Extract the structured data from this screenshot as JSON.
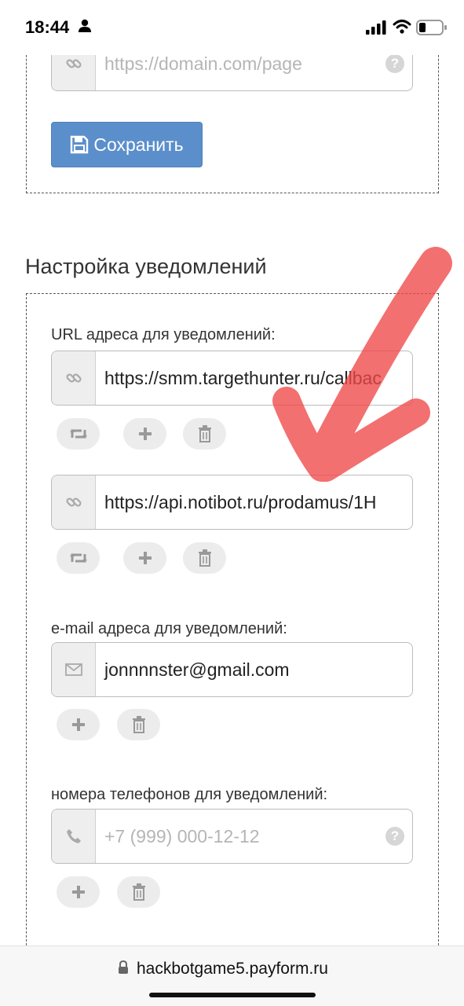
{
  "status_bar": {
    "time": "18:44",
    "icons": [
      "person-icon",
      "signal-icon",
      "wifi-icon",
      "battery-icon"
    ]
  },
  "top_section": {
    "url_field": {
      "placeholder": "https://domain.com/page",
      "icon": "link-icon",
      "help": "?"
    },
    "save_button": {
      "label": "Сохранить",
      "icon": "floppy-disk-icon"
    }
  },
  "notifications": {
    "title": "Настройка уведомлений",
    "url_label": "URL адреса для уведомлений:",
    "url_fields": [
      {
        "value": "https://smm.targethunter.ru/callbac",
        "icon": "link-icon"
      },
      {
        "value": "https://api.notibot.ru/prodamus/1H",
        "icon": "link-icon"
      }
    ],
    "url_actions": [
      "retweet-icon",
      "plus-icon",
      "trash-icon"
    ],
    "email_label": "e-mail адреса для уведомлений:",
    "email_field": {
      "value": "jonnnnster@gmail.com",
      "icon": "envelope-icon"
    },
    "email_actions": [
      "plus-icon",
      "trash-icon"
    ],
    "phone_label": "номера телефонов для уведомлений:",
    "phone_field": {
      "placeholder": "+7 (999) 000-12-12",
      "icon": "phone-icon",
      "help": "?"
    },
    "phone_actions": [
      "plus-icon",
      "trash-icon"
    ]
  },
  "browser": {
    "url": "hackbotgame5.payform.ru"
  },
  "colors": {
    "button_primary": "#5b8fcb",
    "addon_bg": "#eeeeee",
    "scribble": "#f04848"
  }
}
